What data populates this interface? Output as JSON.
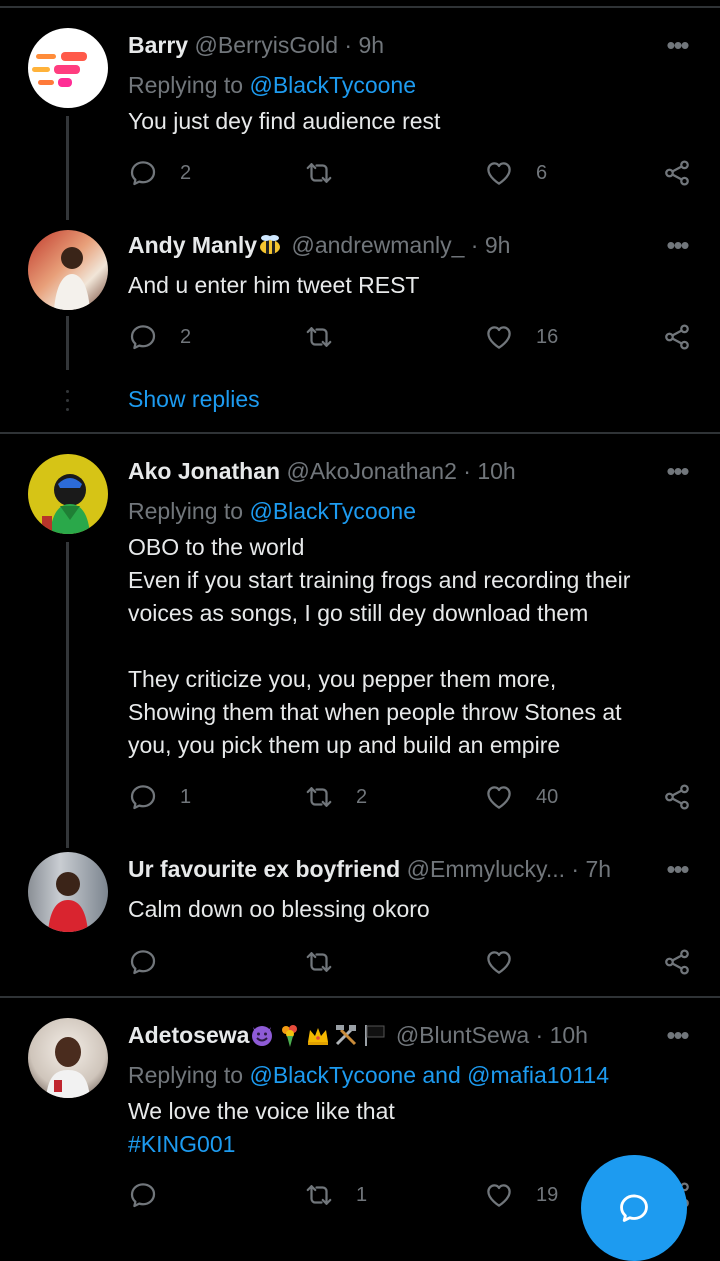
{
  "tweets": [
    {
      "name": "Barry",
      "handle": "@BerryisGold",
      "time": "· 9h",
      "reply_prefix": "Replying to",
      "reply_to": "@BlackTycoone",
      "text": "You just dey find audience rest",
      "replies": "2",
      "retweets": "",
      "likes": "6"
    },
    {
      "name": "Andy Manly",
      "handle": "@andrewmanly_",
      "time": "· 9h",
      "text": "And u enter him tweet REST",
      "replies": "2",
      "retweets": "",
      "likes": "16"
    },
    {
      "name": "Ako Jonathan",
      "handle": "@AkoJonathan2",
      "time": "· 10h",
      "reply_prefix": "Replying to",
      "reply_to": "@BlackTycoone",
      "text_lines": [
        "OBO to the world",
        "Even if you start training frogs and recording their",
        "voices as songs, I go still dey download them",
        "",
        "They criticize you, you pepper them more,",
        "Showing them that when people throw Stones at",
        "you, you pick them up and build an empire"
      ],
      "replies": "1",
      "retweets": "2",
      "likes": "40"
    },
    {
      "name": "Ur favourite ex boyfriend",
      "handle": "@Emmylucky...",
      "time": "· 7h",
      "text": "Calm down oo blessing okoro",
      "replies": "",
      "retweets": "",
      "likes": ""
    },
    {
      "name": "Adetosewa",
      "handle": "@BluntSewa",
      "time": "· 10h",
      "reply_prefix": "Replying to",
      "reply_to": "@BlackTycoone and @mafia10114",
      "text": "We love the voice like that",
      "hashtag": "#KING001",
      "replies": "",
      "retweets": "1",
      "likes": "19"
    }
  ],
  "show_replies": "Show replies",
  "icons": {
    "reply": "reply-icon",
    "retweet": "retweet-icon",
    "like": "heart-icon",
    "share": "share-icon",
    "more": "more-icon",
    "compose": "compose-reply-icon"
  },
  "colors": {
    "background": "#000000",
    "text": "#e7e9ea",
    "muted": "#71767b",
    "accent": "#1d9bf0",
    "divider": "#2f3336"
  }
}
